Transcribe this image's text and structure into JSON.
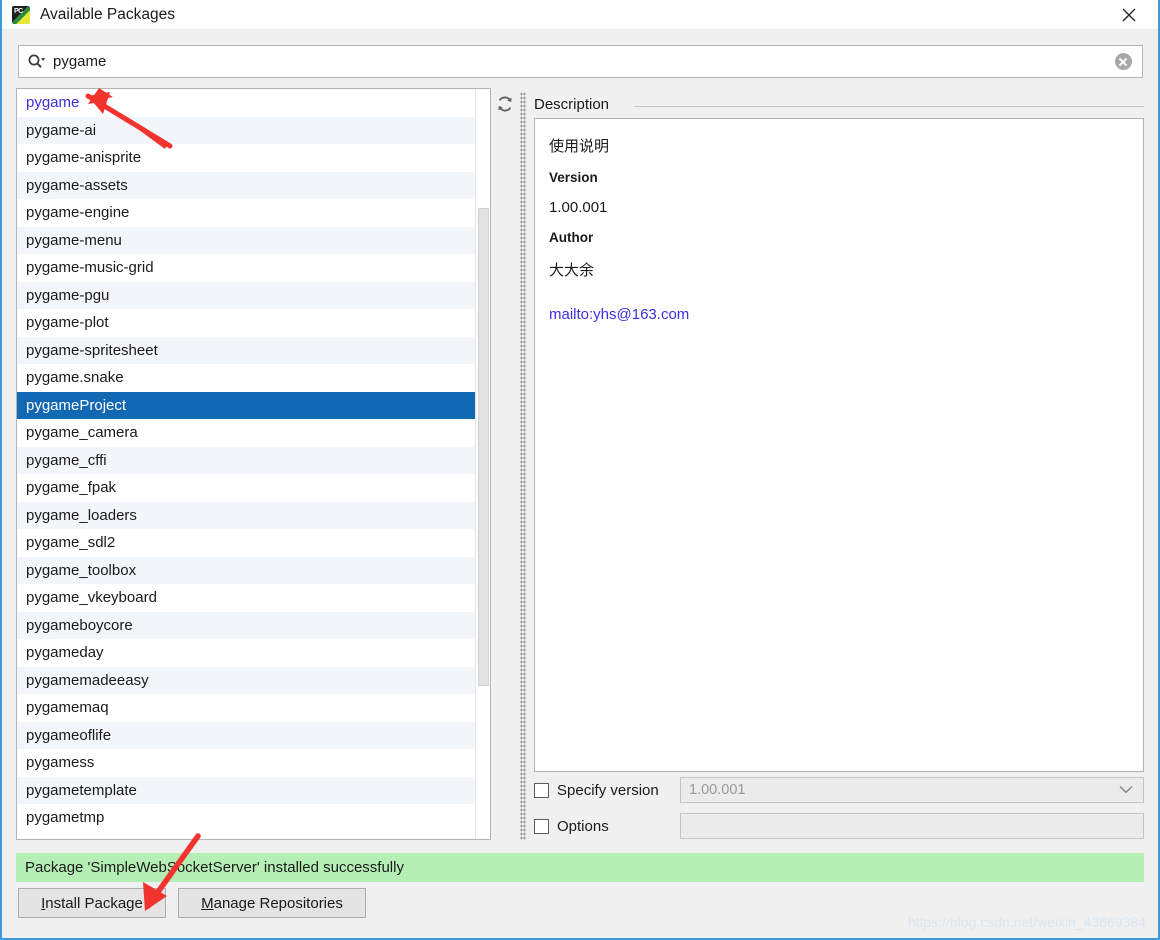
{
  "window": {
    "title": "Available Packages",
    "icon": "pycharm-icon",
    "icon_text": "PC",
    "close_label": "close-icon"
  },
  "search": {
    "value": "pygame",
    "placeholder": "",
    "icon": "search-icon",
    "clear_icon": "clear-icon"
  },
  "list": {
    "refresh_icon": "refresh-icon",
    "items": [
      {
        "name": "pygame",
        "state": "visited"
      },
      {
        "name": "pygame-ai",
        "state": "normal"
      },
      {
        "name": "pygame-anisprite",
        "state": "normal"
      },
      {
        "name": "pygame-assets",
        "state": "normal"
      },
      {
        "name": "pygame-engine",
        "state": "normal"
      },
      {
        "name": "pygame-menu",
        "state": "normal"
      },
      {
        "name": "pygame-music-grid",
        "state": "normal"
      },
      {
        "name": "pygame-pgu",
        "state": "normal"
      },
      {
        "name": "pygame-plot",
        "state": "normal"
      },
      {
        "name": "pygame-spritesheet",
        "state": "normal"
      },
      {
        "name": "pygame.snake",
        "state": "normal"
      },
      {
        "name": "pygameProject",
        "state": "selected"
      },
      {
        "name": "pygame_camera",
        "state": "normal"
      },
      {
        "name": "pygame_cffi",
        "state": "normal"
      },
      {
        "name": "pygame_fpak",
        "state": "normal"
      },
      {
        "name": "pygame_loaders",
        "state": "normal"
      },
      {
        "name": "pygame_sdl2",
        "state": "normal"
      },
      {
        "name": "pygame_toolbox",
        "state": "normal"
      },
      {
        "name": "pygame_vkeyboard",
        "state": "normal"
      },
      {
        "name": "pygameboycore",
        "state": "normal"
      },
      {
        "name": "pygameday",
        "state": "normal"
      },
      {
        "name": "pygamemadeeasy",
        "state": "normal"
      },
      {
        "name": "pygamemaq",
        "state": "normal"
      },
      {
        "name": "pygameoflife",
        "state": "normal"
      },
      {
        "name": "pygamess",
        "state": "normal"
      },
      {
        "name": "pygametemplate",
        "state": "normal"
      },
      {
        "name": "pygametmp",
        "state": "normal"
      }
    ]
  },
  "description": {
    "section_title": "Description",
    "intro": "使用说明",
    "version_label": "Version",
    "version_value": "1.00.001",
    "author_label": "Author",
    "author_value": "大大余",
    "link": "mailto:yhs@163.com"
  },
  "options": {
    "specify_version_label": "Specify version",
    "specify_version_checked": false,
    "specify_version_value": "1.00.001",
    "options_label": "Options",
    "options_checked": false,
    "options_value": ""
  },
  "status": {
    "message": "Package 'SimpleWebSocketServer' installed successfully",
    "background": "#b6efb6"
  },
  "buttons": {
    "install_mnemonic": "I",
    "install_rest": "nstall Package",
    "manage_mnemonic": "M",
    "manage_rest": "anage Repositories"
  },
  "watermark": {
    "text": "https://blog.csdn.net/weixin_43669384"
  },
  "colors": {
    "selection": "#1268b3",
    "link": "#3b2fe0",
    "status_green": "#b6efb6",
    "window_border": "#3c9ade",
    "annotation_red": "#f3332e"
  }
}
